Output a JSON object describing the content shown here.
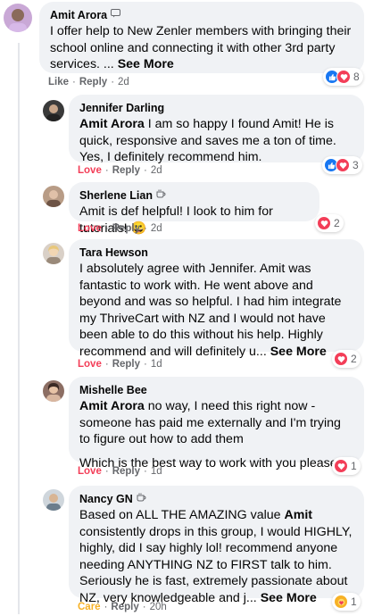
{
  "colors": {
    "like": "#1877f2",
    "love": "#f33e58",
    "care": "#f7b125",
    "bubble": "#f0f2f5",
    "meta": "#65676b"
  },
  "labels": {
    "reply": "Reply",
    "see_more": "See More"
  },
  "comments": [
    {
      "author": "Amit Arora",
      "badge_icon": "chat-badge-icon",
      "text": "I offer help to New Zenler members with bringing their school online and connecting it with other 3rd party services. ...",
      "action": "Like",
      "time": "2d",
      "reactions": [
        "like",
        "love"
      ],
      "reaction_count": "8"
    },
    {
      "author": "Jennifer Darling",
      "mention": "Amit Arora",
      "text": "I am so happy I found Amit! He is quick, responsive and saves me a ton of time. Yes, I definitely recommend him.",
      "action": "Love",
      "time": "2d",
      "reactions": [
        "like",
        "love"
      ],
      "reaction_count": "3"
    },
    {
      "author": "Sherlene Lian",
      "badge_icon": "coffee-cup-icon",
      "text": "Amit is def helpful! I look to him for tutorials! 😀",
      "action": "Love",
      "time": "2d",
      "reactions": [
        "love"
      ],
      "reaction_count": "2"
    },
    {
      "author": "Tara Hewson",
      "text": "I absolutely agree with Jennifer. Amit was fantastic to work with. He went above and beyond and was so helpful. I had him integrate my ThriveCart with NZ and I would not have been able to do this without his help. Highly recommend and will definitely u...",
      "action": "Love",
      "time": "1d",
      "reactions": [
        "love"
      ],
      "reaction_count": "2"
    },
    {
      "author": "Mishelle Bee",
      "mention": "Amit Arora",
      "text": "no way, I need this right now - someone has paid me externally and I'm trying to figure out how to add them",
      "text2": "Which is the best way to work with you please?",
      "action": "Love",
      "time": "1d",
      "reactions": [
        "love"
      ],
      "reaction_count": "1"
    },
    {
      "author": "Nancy GN",
      "badge_icon": "coffee-cup-icon",
      "text_before": "Based on ALL THE AMAZING value",
      "mention": "Amit",
      "text_after": "consistently drops in this group, I would HIGHLY, highly, did I say highly lol! recommend anyone needing ANYTHING NZ to FIRST talk to him. Seriously he is fast, extremely passionate about NZ, very knowledgeable and j...",
      "action": "Care",
      "time": "20h",
      "reactions": [
        "care"
      ],
      "reaction_count": "1"
    }
  ]
}
